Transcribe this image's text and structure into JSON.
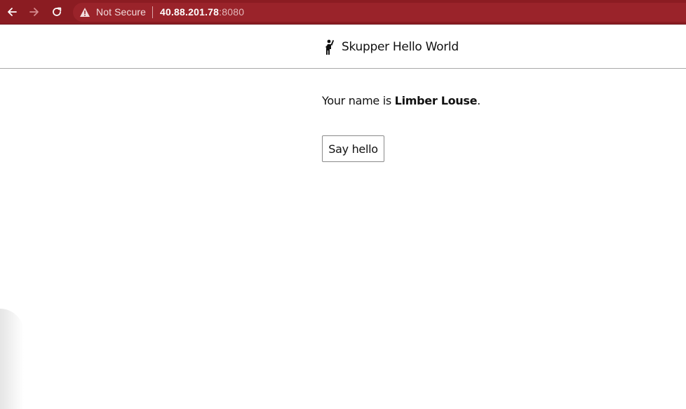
{
  "browser": {
    "security_label": "Not Secure",
    "url_host": "40.88.201.78",
    "url_port": ":8080",
    "icons": {
      "back": "back-arrow-icon",
      "forward": "forward-arrow-icon",
      "reload": "reload-icon",
      "warning": "warning-icon"
    },
    "colors": {
      "bar": "#8b1c22",
      "address": "#9a232a"
    }
  },
  "header": {
    "title": "Skupper Hello World",
    "logo_icon": "person-waving-icon"
  },
  "main": {
    "name_prefix": "Your name is ",
    "name": "Limber Louse",
    "name_suffix": ".",
    "button_label": "Say hello"
  }
}
